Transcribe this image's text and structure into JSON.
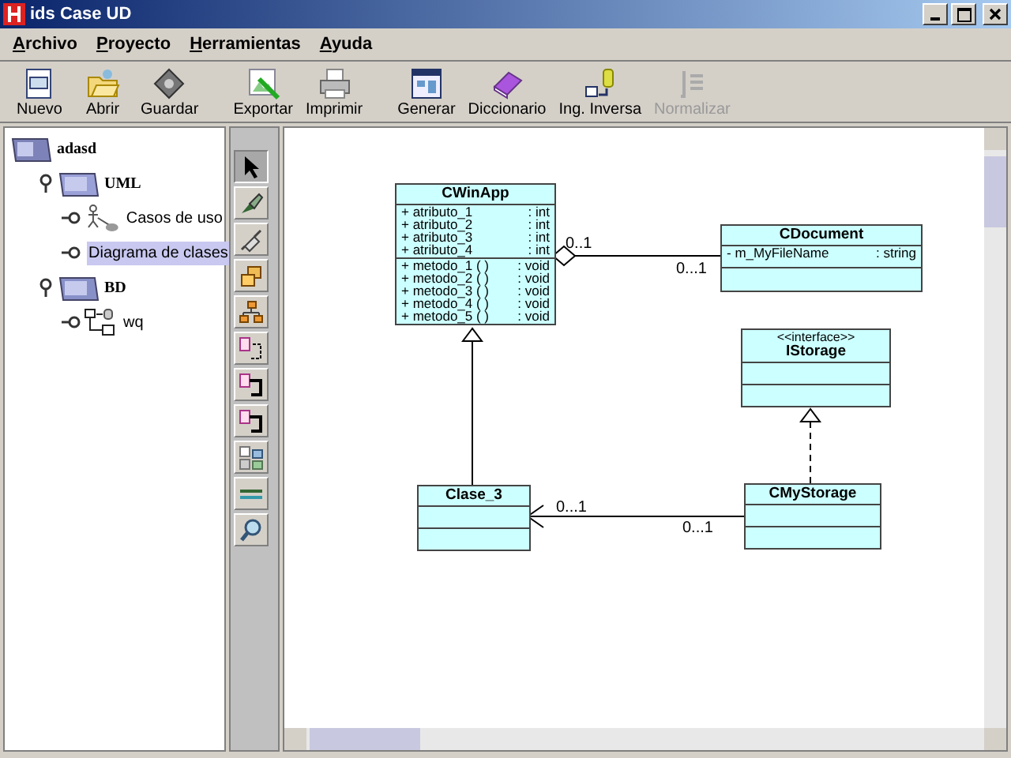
{
  "window": {
    "title": "ids Case UD"
  },
  "menu": [
    {
      "label": "Archivo"
    },
    {
      "label": "Proyecto"
    },
    {
      "label": "Herramientas"
    },
    {
      "label": "Ayuda"
    }
  ],
  "toolbar": [
    {
      "kind": "new",
      "label": "Nuevo",
      "disabled": false
    },
    {
      "kind": "open",
      "label": "Abrir",
      "disabled": false
    },
    {
      "kind": "save",
      "label": "Guardar",
      "disabled": false
    },
    {
      "kind": "export",
      "label": "Exportar",
      "disabled": false
    },
    {
      "kind": "print",
      "label": "Imprimir",
      "disabled": false
    },
    {
      "kind": "generate",
      "label": "Generar",
      "disabled": false
    },
    {
      "kind": "dictionary",
      "label": "Diccionario",
      "disabled": false
    },
    {
      "kind": "reverse",
      "label": "Ing. Inversa",
      "disabled": false
    },
    {
      "kind": "normalize",
      "label": "Normalizar",
      "disabled": true
    }
  ],
  "tree": [
    {
      "kind": "project",
      "label": "adasd",
      "selected": false,
      "children": [
        {
          "kind": "uml",
          "label": "UML",
          "expanded": true,
          "selected": false,
          "children": [
            {
              "kind": "usecase",
              "label": "Casos de uso",
              "expanded": false,
              "selected": false
            },
            {
              "kind": "classdiagram",
              "label": "Diagrama de clases",
              "expanded": false,
              "selected": true
            }
          ]
        },
        {
          "kind": "bd",
          "label": "BD",
          "expanded": true,
          "selected": false,
          "children": [
            {
              "kind": "schema",
              "label": "wq",
              "expanded": false,
              "selected": false
            }
          ]
        }
      ]
    }
  ],
  "tools": [
    {
      "kind": "pointer",
      "selected": true
    },
    {
      "kind": "brush",
      "selected": false
    },
    {
      "kind": "plug",
      "selected": false
    },
    {
      "kind": "boxes",
      "selected": false
    },
    {
      "kind": "hierarchy",
      "selected": false
    },
    {
      "kind": "class",
      "selected": false
    },
    {
      "kind": "link",
      "selected": false
    },
    {
      "kind": "link2",
      "selected": false
    },
    {
      "kind": "classes",
      "selected": false
    },
    {
      "kind": "separator",
      "selected": false
    },
    {
      "kind": "zoom",
      "selected": false
    }
  ],
  "diagram": {
    "classes": [
      {
        "name": "CWinApp",
        "attributes": [
          {
            "name": "+ atributo_1",
            "type": ": int"
          },
          {
            "name": "+ atributo_2",
            "type": ": int"
          },
          {
            "name": "+ atributo_3",
            "type": ": int"
          },
          {
            "name": "+ atributo_4",
            "type": ": int"
          }
        ],
        "methods": [
          {
            "name": "+ metodo_1 ( )",
            "type": ": void"
          },
          {
            "name": "+ metodo_2 ( )",
            "type": ": void"
          },
          {
            "name": "+ metodo_3 ( )",
            "type": ": void"
          },
          {
            "name": "+ metodo_4 ( )",
            "type": ": void"
          },
          {
            "name": "+ metodo_5 ( )",
            "type": ": void"
          }
        ]
      },
      {
        "name": "CDocument",
        "attributes": [
          {
            "name": "- m_MyFileName",
            "type": ": string"
          }
        ]
      },
      {
        "stereotype": "<<interface>>",
        "name": "IStorage"
      },
      {
        "name": "Clase_3"
      },
      {
        "name": "CMyStorage"
      }
    ],
    "relations": [
      {
        "kind": "aggregation",
        "source_label": "0..1",
        "target_label": "0...1"
      },
      {
        "kind": "generalization"
      },
      {
        "kind": "realization"
      },
      {
        "kind": "association",
        "source_label": "0...1",
        "target_label": "0...1"
      }
    ]
  }
}
